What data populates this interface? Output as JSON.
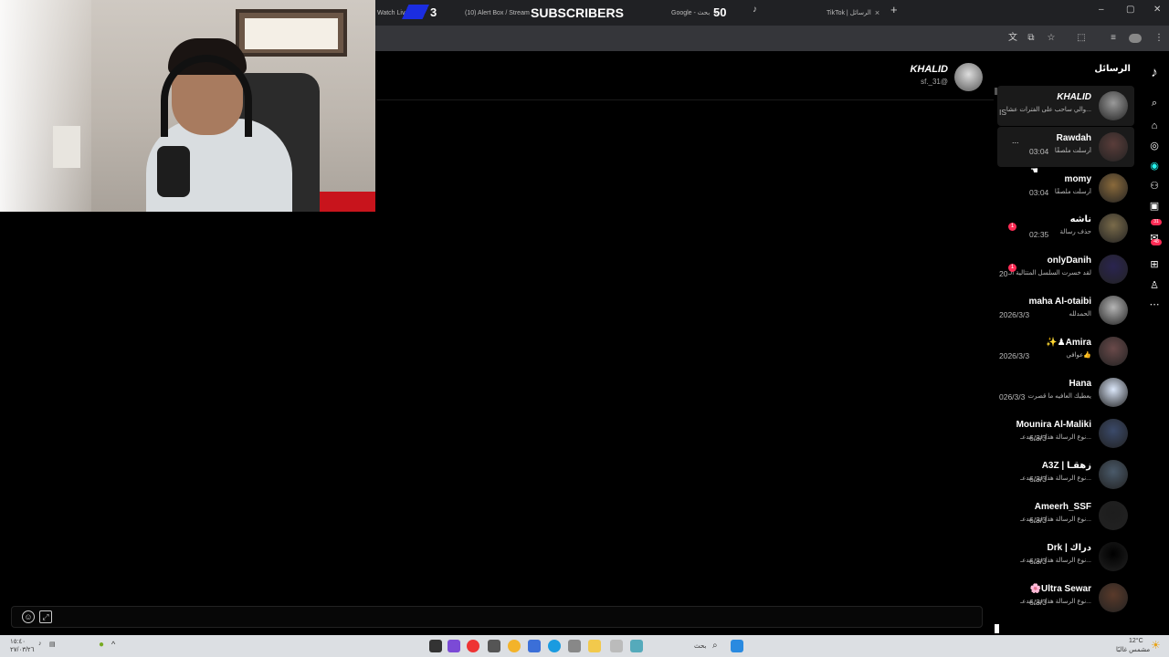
{
  "browser": {
    "tabs": [
      {
        "label": "Watch Live",
        "close": ""
      },
      {
        "label": "(10) Alert Box / Stream",
        "close": "×"
      },
      {
        "label": "Google - بحث",
        "close": "×"
      },
      {
        "label": "TikTok | الرسائل",
        "close": "×"
      }
    ],
    "new_tab": "+",
    "window_controls": [
      "–",
      "▢",
      "✕"
    ]
  },
  "overlay": {
    "left_count": "3",
    "label": "SUBSCRIBERS",
    "right_count": "50"
  },
  "chat_header": {
    "name": "KHALID",
    "handle": "sf._31@"
  },
  "inbox": {
    "title": "الرسائل",
    "conversations": [
      {
        "name": "KHALID",
        "preview": "والي ساحب على الفترات عشا...",
        "time": "",
        "edge_text": "IS",
        "avatar_color": "#9a9a9a",
        "badge": ""
      },
      {
        "name": "Rawdah",
        "preview": "أرسلت ملصقًا",
        "time": "03:04",
        "edge_text": "",
        "avatar_color": "#5a3d3a",
        "badge": "",
        "more": "..."
      },
      {
        "name": "momy",
        "preview": "أرسلت ملصقًا",
        "time": "03:04",
        "edge_text": "",
        "avatar_color": "#8a6a3b",
        "badge": ""
      },
      {
        "name": "ناشه",
        "preview": "حذف رسالة",
        "time": "02:35",
        "edge_text": "",
        "avatar_color": "#7a6b4a",
        "badge": "1"
      },
      {
        "name": "onlyDanih",
        "preview": "لقد خسرت السلسل المتتالية الـ",
        "time": "",
        "edge_text": "20",
        "avatar_color": "#2a2450",
        "badge": "1"
      },
      {
        "name": "maha Al-otaibi",
        "preview": "الحمدلله",
        "time": "2026/3/3",
        "edge_text": "",
        "avatar_color": "#b5b5b5",
        "badge": ""
      },
      {
        "name": "✨♟Amira",
        "preview": "عوافي👍",
        "time": "2026/3/3",
        "edge_text": "",
        "avatar_color": "#6a4a4a",
        "badge": ""
      },
      {
        "name": "Hana",
        "preview": "يعطيك العافيه ما قصرت",
        "time": "026/3/3",
        "edge_text": "",
        "avatar_color": "#dce8fb",
        "badge": ""
      },
      {
        "name": "Mounira Al-Maliki",
        "preview": "نوع الرسالة هذا غير مدعـ...",
        "time": "6/3/3",
        "edge_text": "",
        "avatar_color": "#3b4a6a",
        "badge": ""
      },
      {
        "name": "A3Z | زهقـا",
        "preview": "نوع الرسالة هذا غير مدعـ...",
        "time": "6/3/3",
        "edge_text": "",
        "avatar_color": "#4a5a6a",
        "badge": ""
      },
      {
        "name": "Ameerh_SSF",
        "preview": "نوع الرسالة هذا غير مدعـ...",
        "time": "6/3/3",
        "edge_text": "",
        "avatar_color": "#1d1d1d",
        "badge": ""
      },
      {
        "name": "Drk | دراك",
        "preview": "نوع الرسالة هذا غير مدعـ...",
        "time": "6/3/3",
        "edge_text": "",
        "avatar_color": "#000000",
        "badge": ""
      },
      {
        "name": "🌸Ultra Sewar",
        "preview": "نوع الرسالة هذا غير مدعـ...",
        "time": "6/3/3",
        "edge_text": "",
        "avatar_color": "#5a3a2a",
        "badge": ""
      }
    ]
  },
  "rightnav": {
    "badges": [
      "31",
      "48"
    ]
  },
  "taskbar": {
    "search_label": "بحث",
    "weather": "12°C",
    "weather_desc": "مشمس غالبًا",
    "clock_time": "١٥:٤٠",
    "clock_date": "٢٧/٠٣/٢٦"
  },
  "colors": {
    "accent": "#fe2c55",
    "panel": "#000000",
    "tabbar": "#202124"
  }
}
